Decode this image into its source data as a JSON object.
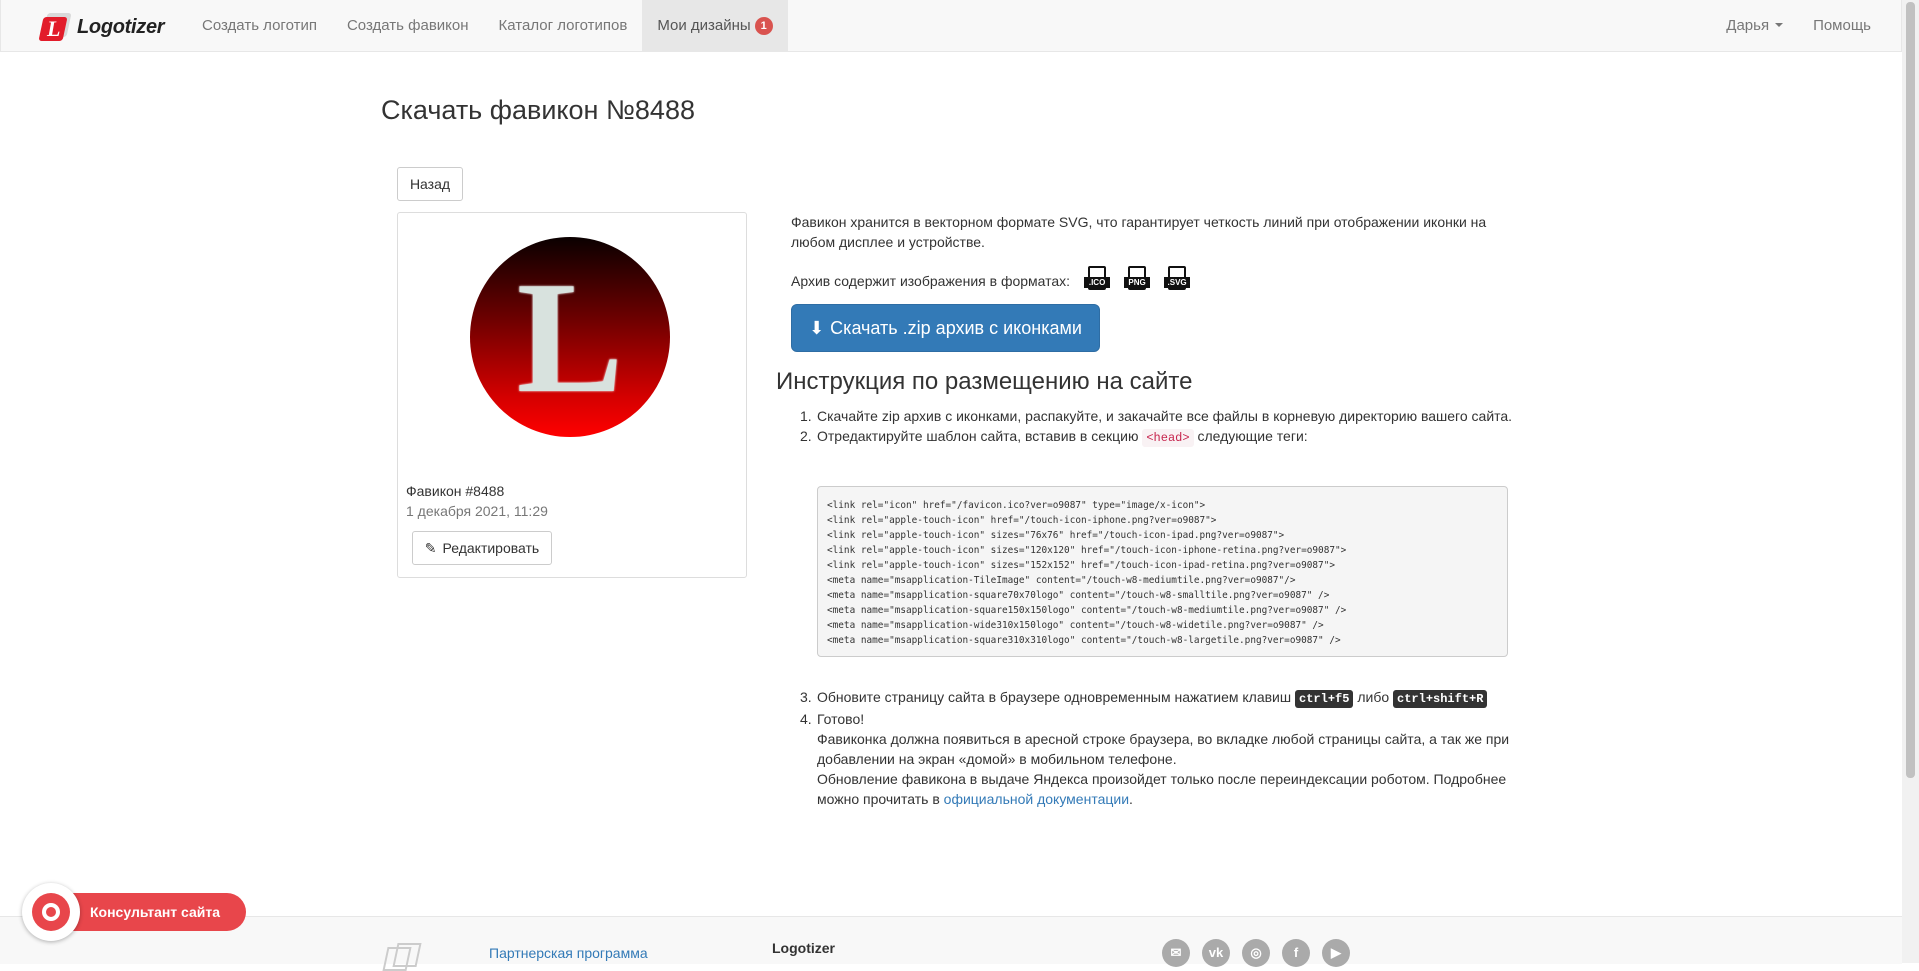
{
  "nav": {
    "brand": "Logotizer",
    "brand_letter": "L",
    "items": [
      {
        "label": "Создать логотип"
      },
      {
        "label": "Создать фавикон"
      },
      {
        "label": "Каталог логотипов"
      },
      {
        "label": "Мои дизайны",
        "badge": "1"
      }
    ],
    "user": "Дарья",
    "help": "Помощь"
  },
  "page": {
    "title": "Скачать фавикон №8488",
    "back_label": "Назад"
  },
  "card": {
    "letter": "L",
    "title": "Фавикон #8488",
    "date": "1 декабря 2021, 11:29",
    "edit_label": "Редактировать"
  },
  "info": {
    "description": "Фавикон хранится в векторном формате SVG, что гарантирует четкость линий при отображении иконки на любом дисплее и устройстве.",
    "formats_label": "Архив содержит изображения в форматах:",
    "formats": [
      ".ICO",
      "PNG",
      ".SVG"
    ],
    "download_label": "Скачать .zip архив с иконками"
  },
  "instructions": {
    "title": "Инструкция по размещению на сайте",
    "step1": "Скачайте zip архив с иконками, распакуйте, и закачайте все файлы в корневую директорию вашего сайта.",
    "step2_before": "Отредактируйте шаблон сайта, вставив в секцию",
    "step2_code": "<head>",
    "step2_after": "следующие теги:",
    "code": "<link rel=\"icon\" href=\"/favicon.ico?ver=o9087\" type=\"image/x-icon\">\n<link rel=\"apple-touch-icon\" href=\"/touch-icon-iphone.png?ver=o9087\">\n<link rel=\"apple-touch-icon\" sizes=\"76x76\" href=\"/touch-icon-ipad.png?ver=o9087\">\n<link rel=\"apple-touch-icon\" sizes=\"120x120\" href=\"/touch-icon-iphone-retina.png?ver=o9087\">\n<link rel=\"apple-touch-icon\" sizes=\"152x152\" href=\"/touch-icon-ipad-retina.png?ver=o9087\">\n<meta name=\"msapplication-TileImage\" content=\"/touch-w8-mediumtile.png?ver=o9087\"/>\n<meta name=\"msapplication-square70x70logo\" content=\"/touch-w8-smalltile.png?ver=o9087\" />\n<meta name=\"msapplication-square150x150logo\" content=\"/touch-w8-mediumtile.png?ver=o9087\" />\n<meta name=\"msapplication-wide310x150logo\" content=\"/touch-w8-widetile.png?ver=o9087\" />\n<meta name=\"msapplication-square310x310logo\" content=\"/touch-w8-largetile.png?ver=o9087\" />",
    "step3_before": "Обновите страницу сайта в браузере одновременным нажатием клавиш",
    "kbd1": "ctrl+f5",
    "step3_mid": "либо",
    "kbd2": "ctrl+shift+R",
    "step4_title": "Готово!",
    "step4_p1": "Фавиконка должна появиться в аресной строке браузера, во вкладке любой страницы сайта, а так же при добавлении на экран «домой» в мобильном телефоне.",
    "step4_p2": "Обновление фавикона в выдаче Яндекса произойдет только после переиндексации роботом. Подробнее можно прочитать в",
    "step4_link": "официальной документации",
    "step4_end": "."
  },
  "consultant": {
    "label": "Консультант сайта"
  },
  "footer": {
    "partner_link": "Партнерская программа",
    "brand": "Logotizer",
    "socials": [
      "mail-icon",
      "vk-icon",
      "instagram-icon",
      "facebook-icon",
      "youtube-icon"
    ]
  }
}
